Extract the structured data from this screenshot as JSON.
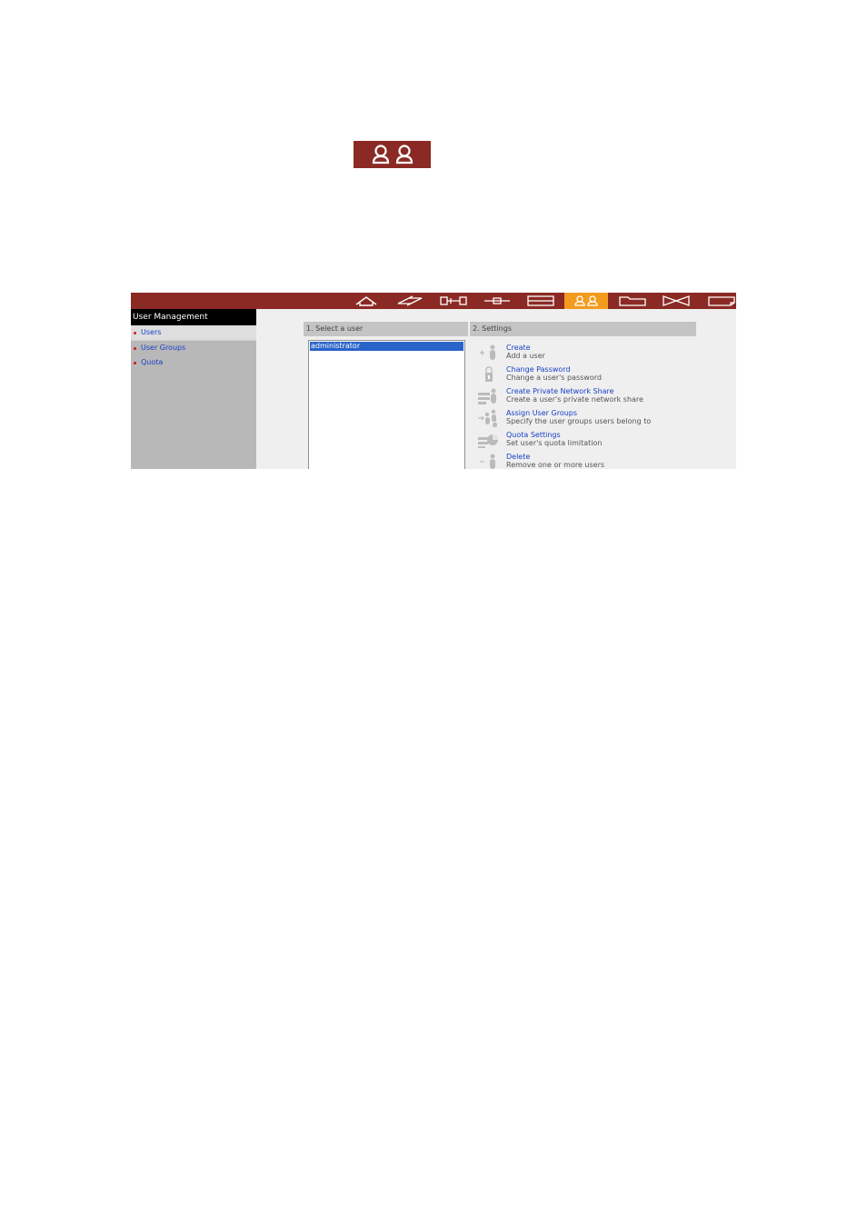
{
  "top_icon": {
    "name": "user-management-icon"
  },
  "nav": {
    "icons": [
      "home-icon",
      "lightning-icon",
      "network-icon",
      "plus-tool-icon",
      "disk-icon",
      "users-icon",
      "folder-icon",
      "sync-icon",
      "note-icon"
    ],
    "active_index": 5,
    "bar_color": "#8b2a24",
    "active_color": "#f39b1f"
  },
  "sidebar": {
    "title": "User Management",
    "items": [
      {
        "label": "Users"
      },
      {
        "label": "User Groups"
      },
      {
        "label": "Quota"
      }
    ]
  },
  "main": {
    "select_header": "1. Select a user",
    "settings_header": "2. Settings",
    "users": [
      "administrator"
    ],
    "settings": [
      {
        "label": "Create",
        "description": "Add a user",
        "icon": "add-user-icon"
      },
      {
        "label": "Change Password",
        "description": "Change a user's password",
        "icon": "password-icon"
      },
      {
        "label": "Create Private Network Share",
        "description": "Create a user's private network share",
        "icon": "private-share-icon"
      },
      {
        "label": "Assign User Groups",
        "description": "Specify the user groups users belong to",
        "icon": "assign-groups-icon"
      },
      {
        "label": "Quota Settings",
        "description": "Set user's quota limitation",
        "icon": "quota-icon"
      },
      {
        "label": "Delete",
        "description": "Remove one or more users",
        "icon": "delete-user-icon"
      }
    ]
  }
}
